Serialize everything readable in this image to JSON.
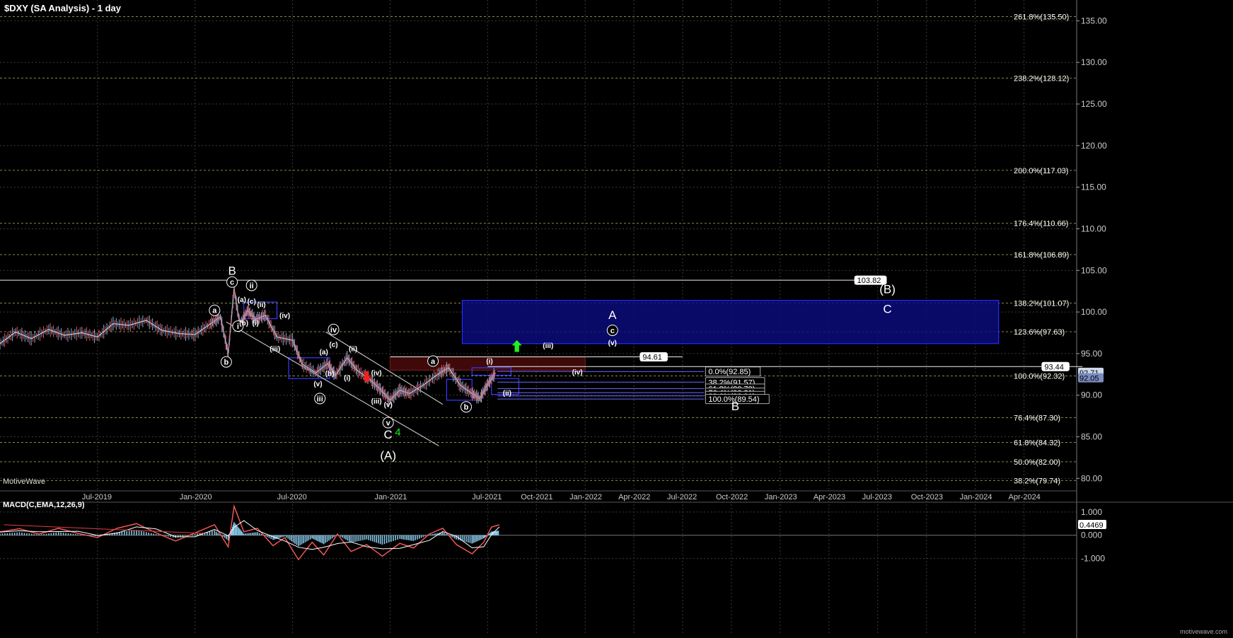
{
  "header": {
    "title": "$DXY (SA Analysis) - 1 day",
    "brand": "MotiveWave",
    "site": "motivewave.com"
  },
  "colors": {
    "background": "#000000",
    "grid": "#3a3a3a",
    "fib_line": "#8a8a4a",
    "zone_fill": "#0a0a7a",
    "zone_border": "#2a2aff",
    "red_zone": "#4a0a0a",
    "up_arrow": "#22ee22",
    "down_arrow": "#ee2222",
    "price": "#cfd8e8",
    "macd": "#ff5a5a",
    "signal": "#ffffff",
    "hist": "#87c6e6"
  },
  "chart_data": {
    "type": "line",
    "title": "$DXY (SA Analysis) - 1 day",
    "x_ticks": [
      {
        "label": "Jul-2019",
        "t": 0.5
      },
      {
        "label": "Jan-2020",
        "t": 1.0
      },
      {
        "label": "Jul-2020",
        "t": 1.5
      },
      {
        "label": "Jan-2021",
        "t": 2.0
      },
      {
        "label": "Jul-2021",
        "t": 2.5
      },
      {
        "label": "Oct-2021",
        "t": 2.75
      },
      {
        "label": "Jan-2022",
        "t": 3.0
      },
      {
        "label": "Apr-2022",
        "t": 3.25
      },
      {
        "label": "Jul-2022",
        "t": 3.5
      },
      {
        "label": "Oct-2022",
        "t": 3.75
      },
      {
        "label": "Jan-2023",
        "t": 4.0
      },
      {
        "label": "Apr-2023",
        "t": 4.25
      },
      {
        "label": "Jul-2023",
        "t": 4.5
      },
      {
        "label": "Oct-2023",
        "t": 4.75
      },
      {
        "label": "Jan-2024",
        "t": 5.0
      },
      {
        "label": "Apr-2024",
        "t": 5.25
      }
    ],
    "y_ticks": [
      "80.00",
      "85.00",
      "90.00",
      "95.00",
      "100.00",
      "105.00",
      "110.00",
      "115.00",
      "120.00",
      "125.00",
      "130.00",
      "135.00"
    ],
    "ylim": [
      78.5,
      137.5
    ],
    "fib_levels": [
      {
        "label": "261.8%(135.50)",
        "v": 135.5
      },
      {
        "label": "238.2%(128.12)",
        "v": 128.12
      },
      {
        "label": "200.0%(117.03)",
        "v": 117.03
      },
      {
        "label": "176.4%(110.66)",
        "v": 110.66
      },
      {
        "label": "161.8%(106.89)",
        "v": 106.89
      },
      {
        "label": "138.2%(101.07)",
        "v": 101.07
      },
      {
        "label": "123.6%(97.63)",
        "v": 97.63
      },
      {
        "label": "100.0%(92.32)",
        "v": 92.32
      },
      {
        "label": "76.4%(87.30)",
        "v": 87.3
      },
      {
        "label": "61.8%(84.32)",
        "v": 84.32
      },
      {
        "label": "50.0%(82.00)",
        "v": 82.0
      },
      {
        "label": "38.2%(79.74)",
        "v": 79.74
      }
    ],
    "retrace_levels": [
      {
        "label": "0.0%(92.85)",
        "v": 92.85
      },
      {
        "label": "38.2%(91.57)",
        "v": 91.57
      },
      {
        "label": "61.8%(90.79)",
        "v": 90.79
      },
      {
        "label": "76.4%(90.31)",
        "v": 90.31
      },
      {
        "label": "88.6%(89.91)",
        "v": 89.91
      },
      {
        "label": "100.0%(89.54)",
        "v": 89.54
      }
    ],
    "horizontal_lines": [
      {
        "label": "103.82",
        "v": 103.82,
        "t_end": 4.49
      },
      {
        "label": "94.61",
        "v": 94.61,
        "t_start": 2.0,
        "t_end": 3.5
      },
      {
        "label": "93.44",
        "v": 93.44,
        "t_start": 2.5,
        "t_end": 5.55
      }
    ],
    "price_tags": [
      {
        "label": "92.71",
        "v": 92.71
      },
      {
        "label": "92.05",
        "v": 92.05
      }
    ],
    "price": [
      {
        "t": 0.0,
        "v": 96.2
      },
      {
        "t": 0.08,
        "v": 97.6
      },
      {
        "t": 0.16,
        "v": 96.8
      },
      {
        "t": 0.25,
        "v": 97.9
      },
      {
        "t": 0.33,
        "v": 97.2
      },
      {
        "t": 0.42,
        "v": 97.5
      },
      {
        "t": 0.5,
        "v": 97.0
      },
      {
        "t": 0.58,
        "v": 98.6
      },
      {
        "t": 0.66,
        "v": 98.4
      },
      {
        "t": 0.75,
        "v": 99.0
      },
      {
        "t": 0.83,
        "v": 97.8
      },
      {
        "t": 0.92,
        "v": 97.4
      },
      {
        "t": 1.0,
        "v": 97.3
      },
      {
        "t": 1.08,
        "v": 98.6
      },
      {
        "t": 1.13,
        "v": 99.4
      },
      {
        "t": 1.17,
        "v": 95.0
      },
      {
        "t": 1.2,
        "v": 102.8
      },
      {
        "t": 1.23,
        "v": 98.4
      },
      {
        "t": 1.27,
        "v": 100.2
      },
      {
        "t": 1.31,
        "v": 99.1
      },
      {
        "t": 1.36,
        "v": 99.6
      },
      {
        "t": 1.42,
        "v": 97.0
      },
      {
        "t": 1.5,
        "v": 96.6
      },
      {
        "t": 1.55,
        "v": 93.7
      },
      {
        "t": 1.62,
        "v": 92.7
      },
      {
        "t": 1.68,
        "v": 93.8
      },
      {
        "t": 1.72,
        "v": 92.4
      },
      {
        "t": 1.78,
        "v": 94.5
      },
      {
        "t": 1.83,
        "v": 93.0
      },
      {
        "t": 1.9,
        "v": 91.8
      },
      {
        "t": 1.95,
        "v": 90.7
      },
      {
        "t": 2.0,
        "v": 89.4
      },
      {
        "t": 2.05,
        "v": 90.6
      },
      {
        "t": 2.1,
        "v": 90.2
      },
      {
        "t": 2.17,
        "v": 91.2
      },
      {
        "t": 2.25,
        "v": 92.6
      },
      {
        "t": 2.3,
        "v": 93.3
      },
      {
        "t": 2.36,
        "v": 91.2
      },
      {
        "t": 2.42,
        "v": 90.2
      },
      {
        "t": 2.46,
        "v": 89.6
      },
      {
        "t": 2.5,
        "v": 91.3
      },
      {
        "t": 2.54,
        "v": 92.7
      }
    ],
    "macd": {
      "label": "MACD(C,EMA,12,26,9)",
      "value_label": "0.4469",
      "y_ticks": [
        "1.000",
        "0.000",
        "-1.000"
      ],
      "ylim": [
        -1.5,
        1.3
      ],
      "series": [
        {
          "t": 0.0,
          "v": 0.15
        },
        {
          "t": 0.1,
          "v": 0.28
        },
        {
          "t": 0.2,
          "v": 0.05
        },
        {
          "t": 0.3,
          "v": 0.3
        },
        {
          "t": 0.4,
          "v": 0.08
        },
        {
          "t": 0.5,
          "v": -0.1
        },
        {
          "t": 0.6,
          "v": 0.3
        },
        {
          "t": 0.7,
          "v": 0.5
        },
        {
          "t": 0.8,
          "v": 0.1
        },
        {
          "t": 0.9,
          "v": -0.25
        },
        {
          "t": 1.0,
          "v": 0.1
        },
        {
          "t": 1.1,
          "v": 0.45
        },
        {
          "t": 1.17,
          "v": -0.5
        },
        {
          "t": 1.2,
          "v": 1.25
        },
        {
          "t": 1.25,
          "v": 0.15
        },
        {
          "t": 1.32,
          "v": 0.3
        },
        {
          "t": 1.4,
          "v": -0.45
        },
        {
          "t": 1.46,
          "v": -0.1
        },
        {
          "t": 1.53,
          "v": -1.05
        },
        {
          "t": 1.6,
          "v": -0.3
        },
        {
          "t": 1.66,
          "v": -0.85
        },
        {
          "t": 1.73,
          "v": 0.05
        },
        {
          "t": 1.8,
          "v": -0.7
        },
        {
          "t": 1.88,
          "v": -0.4
        },
        {
          "t": 1.96,
          "v": -0.9
        },
        {
          "t": 2.05,
          "v": -0.35
        },
        {
          "t": 2.12,
          "v": -0.55
        },
        {
          "t": 2.2,
          "v": 0.05
        },
        {
          "t": 2.27,
          "v": 0.3
        },
        {
          "t": 2.34,
          "v": -0.4
        },
        {
          "t": 2.42,
          "v": -0.8
        },
        {
          "t": 2.48,
          "v": -0.3
        },
        {
          "t": 2.52,
          "v": 0.35
        },
        {
          "t": 2.56,
          "v": 0.45
        }
      ]
    },
    "annotations": [
      {
        "text": "B",
        "t": 1.19,
        "v": 105.0,
        "size": 17,
        "circle": false
      },
      {
        "text": "c",
        "t": 1.19,
        "v": 103.6,
        "size": 11,
        "circle": true
      },
      {
        "text": "ii",
        "t": 1.29,
        "v": 103.2,
        "size": 11,
        "circle": true
      },
      {
        "text": "a",
        "t": 1.1,
        "v": 100.2,
        "size": 11,
        "circle": true
      },
      {
        "text": "(a)",
        "t": 1.24,
        "v": 101.5,
        "size": 10,
        "circle": false
      },
      {
        "text": "(c)",
        "t": 1.29,
        "v": 101.3,
        "size": 10,
        "circle": false
      },
      {
        "text": "(ii)",
        "t": 1.34,
        "v": 100.9,
        "size": 10,
        "circle": false
      },
      {
        "text": "i",
        "t": 1.22,
        "v": 98.3,
        "size": 11,
        "circle": true
      },
      {
        "text": "(b)",
        "t": 1.25,
        "v": 98.7,
        "size": 10,
        "circle": false
      },
      {
        "text": "(i)",
        "t": 1.31,
        "v": 98.7,
        "size": 10,
        "circle": false
      },
      {
        "text": "(iv)",
        "t": 1.46,
        "v": 99.6,
        "size": 10,
        "circle": false
      },
      {
        "text": "b",
        "t": 1.16,
        "v": 94.0,
        "size": 11,
        "circle": true
      },
      {
        "text": "(iii)",
        "t": 1.41,
        "v": 95.6,
        "size": 10,
        "circle": false
      },
      {
        "text": "iv",
        "t": 1.71,
        "v": 97.9,
        "size": 11,
        "circle": true
      },
      {
        "text": "(c)",
        "t": 1.71,
        "v": 96.1,
        "size": 10,
        "circle": false
      },
      {
        "text": "(ii)",
        "t": 1.81,
        "v": 95.6,
        "size": 10,
        "circle": false
      },
      {
        "text": "(a)",
        "t": 1.66,
        "v": 95.2,
        "size": 10,
        "circle": false
      },
      {
        "text": "(b)",
        "t": 1.69,
        "v": 92.6,
        "size": 10,
        "circle": false
      },
      {
        "text": "(v)",
        "t": 1.63,
        "v": 91.4,
        "size": 10,
        "circle": false
      },
      {
        "text": "iii",
        "t": 1.64,
        "v": 89.6,
        "size": 11,
        "circle": true
      },
      {
        "text": "(i)",
        "t": 1.78,
        "v": 92.1,
        "size": 10,
        "circle": false
      },
      {
        "text": "(iv)",
        "t": 1.93,
        "v": 92.7,
        "size": 10,
        "circle": false
      },
      {
        "text": "(iii)",
        "t": 1.93,
        "v": 89.3,
        "size": 10,
        "circle": false
      },
      {
        "text": "(v)",
        "t": 1.99,
        "v": 88.9,
        "size": 10,
        "circle": false
      },
      {
        "text": "v",
        "t": 1.99,
        "v": 86.7,
        "size": 11,
        "circle": true
      },
      {
        "text": "C",
        "t": 1.99,
        "v": 85.3,
        "size": 17,
        "circle": false
      },
      {
        "text": "4",
        "t": 2.04,
        "v": 85.6,
        "size": 15,
        "circle": false,
        "color": "#22ee22"
      },
      {
        "text": "(A)",
        "t": 1.99,
        "v": 82.8,
        "size": 17,
        "circle": false
      },
      {
        "text": "a",
        "t": 2.22,
        "v": 94.1,
        "size": 11,
        "circle": true
      },
      {
        "text": "b",
        "t": 2.39,
        "v": 88.6,
        "size": 11,
        "circle": true
      },
      {
        "text": "(i)",
        "t": 2.51,
        "v": 94.1,
        "size": 10,
        "circle": false
      },
      {
        "text": "(ii)",
        "t": 2.6,
        "v": 90.3,
        "size": 10,
        "circle": false
      },
      {
        "text": "(iii)",
        "t": 2.81,
        "v": 96.0,
        "size": 10,
        "circle": false
      },
      {
        "text": "(iv)",
        "t": 2.96,
        "v": 92.8,
        "size": 10,
        "circle": false
      },
      {
        "text": "A",
        "t": 3.14,
        "v": 99.7,
        "size": 17,
        "circle": false
      },
      {
        "text": "c",
        "t": 3.14,
        "v": 97.8,
        "size": 11,
        "circle": true
      },
      {
        "text": "(v)",
        "t": 3.14,
        "v": 96.3,
        "size": 10,
        "circle": false
      },
      {
        "text": "(B)",
        "t": 4.55,
        "v": 102.8,
        "size": 17,
        "circle": false
      },
      {
        "text": "C",
        "t": 4.55,
        "v": 100.4,
        "size": 17,
        "circle": false
      },
      {
        "text": "B",
        "t": 3.77,
        "v": 88.7,
        "size": 17,
        "circle": false
      }
    ],
    "zones": [
      {
        "name": "target-zone",
        "t0": 2.37,
        "t1": 5.12,
        "v0": 101.4,
        "v1": 96.2,
        "color": "#0a0a7a",
        "border": "#2a2aff"
      },
      {
        "name": "red-zone",
        "t0": 2.0,
        "t1": 3.0,
        "v0": 94.6,
        "v1": 93.0,
        "color": "#4a0a0a",
        "border": "#6a1a1a"
      },
      {
        "name": "box-ii",
        "t0": 1.25,
        "t1": 1.42,
        "v0": 101.2,
        "v1": 99.2,
        "color": "none",
        "border": "#3a3aff"
      },
      {
        "name": "box-iii",
        "t0": 1.48,
        "t1": 1.69,
        "v0": 94.5,
        "v1": 92.0,
        "color": "none",
        "border": "#3a3aff"
      },
      {
        "name": "box-b",
        "t0": 2.29,
        "t1": 2.42,
        "v0": 91.9,
        "v1": 89.4,
        "color": "none",
        "border": "#3a3aff"
      },
      {
        "name": "box-i",
        "t0": 2.42,
        "t1": 2.62,
        "v0": 93.3,
        "v1": 92.4,
        "color": "none",
        "border": "#3a3aff"
      },
      {
        "name": "box-ii-target",
        "t0": 2.52,
        "t1": 2.66,
        "v0": 92.0,
        "v1": 90.1,
        "color": "none",
        "border": "#3a3aff"
      }
    ],
    "channel_lines": [
      {
        "t0": 1.16,
        "v0": 98.8,
        "t1": 2.25,
        "v1": 83.9
      },
      {
        "t0": 1.67,
        "v0": 97.6,
        "t1": 2.27,
        "v1": 88.9
      }
    ],
    "arrows": [
      {
        "dir": "up",
        "t": 2.65,
        "v": 95.8,
        "color": "#22ee22"
      },
      {
        "dir": "down",
        "t": 1.88,
        "v": 92.3,
        "color": "#ee2222"
      }
    ]
  }
}
